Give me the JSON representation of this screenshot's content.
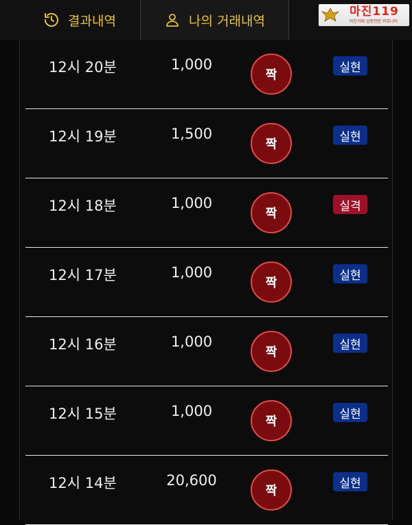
{
  "tabs": [
    {
      "label": "결과내역",
      "icon": "history-icon"
    },
    {
      "label": "나의 거래내역",
      "icon": "user-icon"
    }
  ],
  "logo": {
    "main": "마진119",
    "sub": "마진거래 검증전문 커뮤니티"
  },
  "colors": {
    "accent": "#e8c13a",
    "bet_fill": "#7a0c10",
    "bet_border": "#e24a4a",
    "status_success": "#0b2f8a",
    "status_fail": "#9e1027"
  },
  "rows": [
    {
      "time": "12시 20분",
      "amount": "1,000",
      "bet": "짝",
      "status": "실현",
      "status_type": "success"
    },
    {
      "time": "12시 19분",
      "amount": "1,500",
      "bet": "짝",
      "status": "실현",
      "status_type": "success"
    },
    {
      "time": "12시 18분",
      "amount": "1,000",
      "bet": "짝",
      "status": "실격",
      "status_type": "fail"
    },
    {
      "time": "12시 17분",
      "amount": "1,000",
      "bet": "짝",
      "status": "실현",
      "status_type": "success"
    },
    {
      "time": "12시 16분",
      "amount": "1,000",
      "bet": "짝",
      "status": "실현",
      "status_type": "success"
    },
    {
      "time": "12시 15분",
      "amount": "1,000",
      "bet": "짝",
      "status": "실현",
      "status_type": "success"
    },
    {
      "time": "12시 14분",
      "amount": "20,600",
      "bet": "짝",
      "status": "실현",
      "status_type": "success"
    }
  ]
}
